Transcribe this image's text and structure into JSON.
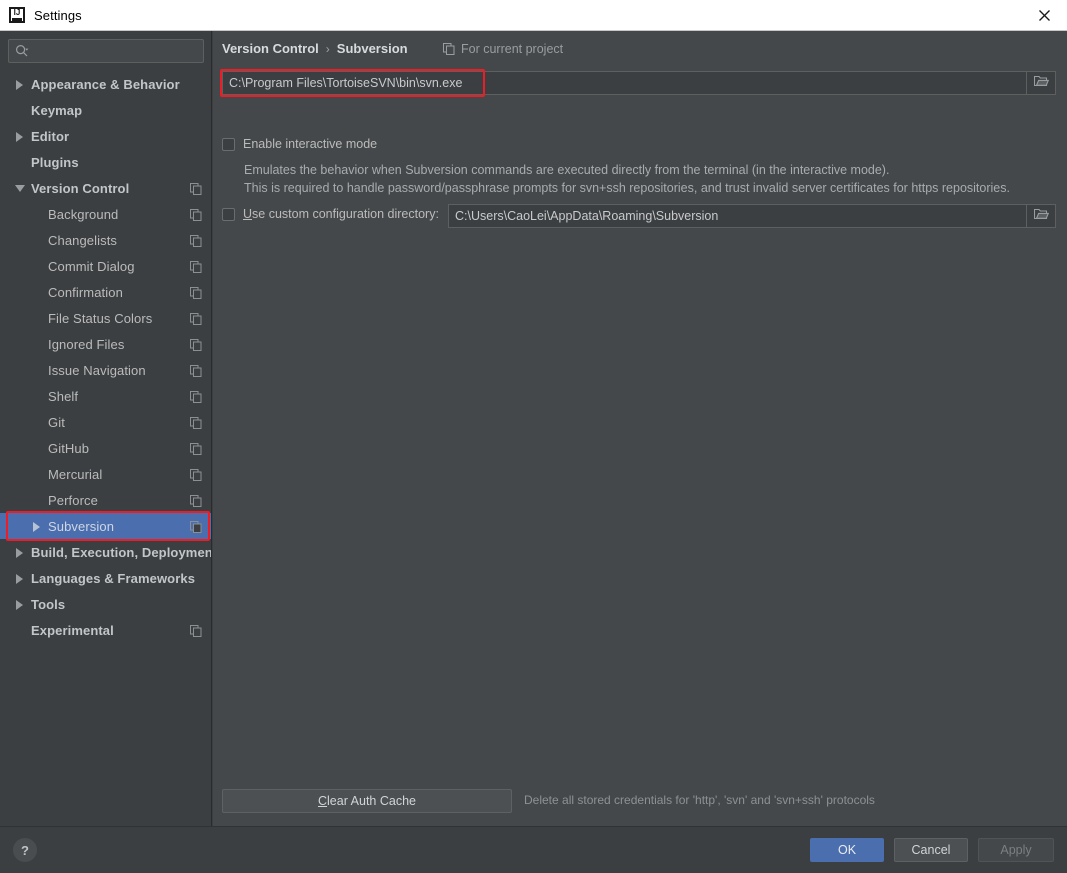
{
  "window": {
    "title": "Settings",
    "app_icon": "intellij-idea-icon",
    "close_icon": "close-icon"
  },
  "search": {
    "value": "",
    "placeholder": "",
    "icon": "search-icon"
  },
  "sidebar": {
    "items": [
      {
        "label": "Appearance & Behavior",
        "level": 0,
        "arrow": "collapsed",
        "copy": false,
        "selected": false
      },
      {
        "label": "Keymap",
        "level": 0,
        "arrow": "none",
        "copy": false,
        "selected": false
      },
      {
        "label": "Editor",
        "level": 0,
        "arrow": "collapsed",
        "copy": false,
        "selected": false
      },
      {
        "label": "Plugins",
        "level": 0,
        "arrow": "none",
        "copy": false,
        "selected": false
      },
      {
        "label": "Version Control",
        "level": 0,
        "arrow": "expanded",
        "copy": true,
        "selected": false
      },
      {
        "label": "Background",
        "level": 1,
        "arrow": "none",
        "copy": true,
        "selected": false
      },
      {
        "label": "Changelists",
        "level": 1,
        "arrow": "none",
        "copy": true,
        "selected": false
      },
      {
        "label": "Commit Dialog",
        "level": 1,
        "arrow": "none",
        "copy": true,
        "selected": false
      },
      {
        "label": "Confirmation",
        "level": 1,
        "arrow": "none",
        "copy": true,
        "selected": false
      },
      {
        "label": "File Status Colors",
        "level": 1,
        "arrow": "none",
        "copy": true,
        "selected": false
      },
      {
        "label": "Ignored Files",
        "level": 1,
        "arrow": "none",
        "copy": true,
        "selected": false
      },
      {
        "label": "Issue Navigation",
        "level": 1,
        "arrow": "none",
        "copy": true,
        "selected": false
      },
      {
        "label": "Shelf",
        "level": 1,
        "arrow": "none",
        "copy": true,
        "selected": false
      },
      {
        "label": "Git",
        "level": 1,
        "arrow": "none",
        "copy": true,
        "selected": false
      },
      {
        "label": "GitHub",
        "level": 1,
        "arrow": "none",
        "copy": true,
        "selected": false
      },
      {
        "label": "Mercurial",
        "level": 1,
        "arrow": "none",
        "copy": true,
        "selected": false
      },
      {
        "label": "Perforce",
        "level": 1,
        "arrow": "none",
        "copy": true,
        "selected": false
      },
      {
        "label": "Subversion",
        "level": 1,
        "arrow": "collapsed",
        "copy": true,
        "selected": true
      },
      {
        "label": "Build, Execution, Deployment",
        "level": 0,
        "arrow": "collapsed",
        "copy": false,
        "selected": false
      },
      {
        "label": "Languages & Frameworks",
        "level": 0,
        "arrow": "collapsed",
        "copy": false,
        "selected": false
      },
      {
        "label": "Tools",
        "level": 0,
        "arrow": "collapsed",
        "copy": false,
        "selected": false
      },
      {
        "label": "Experimental",
        "level": 0,
        "arrow": "none",
        "copy": true,
        "selected": false
      }
    ]
  },
  "main": {
    "breadcrumb": {
      "root": "Version Control",
      "separator": "›",
      "current": "Subversion"
    },
    "for_current_project": {
      "label": "For current project",
      "icon": "copy-icon"
    },
    "svn_path": {
      "value": "C:\\Program Files\\TortoiseSVN\\bin\\svn.exe",
      "browse_icon": "folder-icon"
    },
    "interactive_mode": {
      "label": "Enable interactive mode",
      "checked": false
    },
    "description": [
      "Emulates the behavior when Subversion commands are executed directly from the terminal (in the interactive mode).",
      "This is required to handle password/passphrase prompts for svn+ssh repositories, and trust invalid server certificates for https repositories."
    ],
    "custom_config_dir": {
      "label_before": "U",
      "label_after": "se custom configuration directory:",
      "checked": false,
      "value": "C:\\Users\\CaoLei\\AppData\\Roaming\\Subversion",
      "browse_icon": "folder-icon"
    },
    "clear_auth_cache": {
      "mnemonic": "C",
      "label_rest": "lear Auth Cache",
      "note": "Delete all stored credentials for 'http', 'svn' and 'svn+ssh' protocols"
    }
  },
  "footer": {
    "help_label": "?",
    "ok_label": "OK",
    "cancel_label": "Cancel",
    "apply_label": "Apply"
  },
  "colors": {
    "accent_blue": "#4b6eaf",
    "annotation_red": "#ee1c24",
    "sidebar_bg": "#3c3f41",
    "content_bg": "#45484a",
    "titlebar_bg": "#ffffff"
  }
}
